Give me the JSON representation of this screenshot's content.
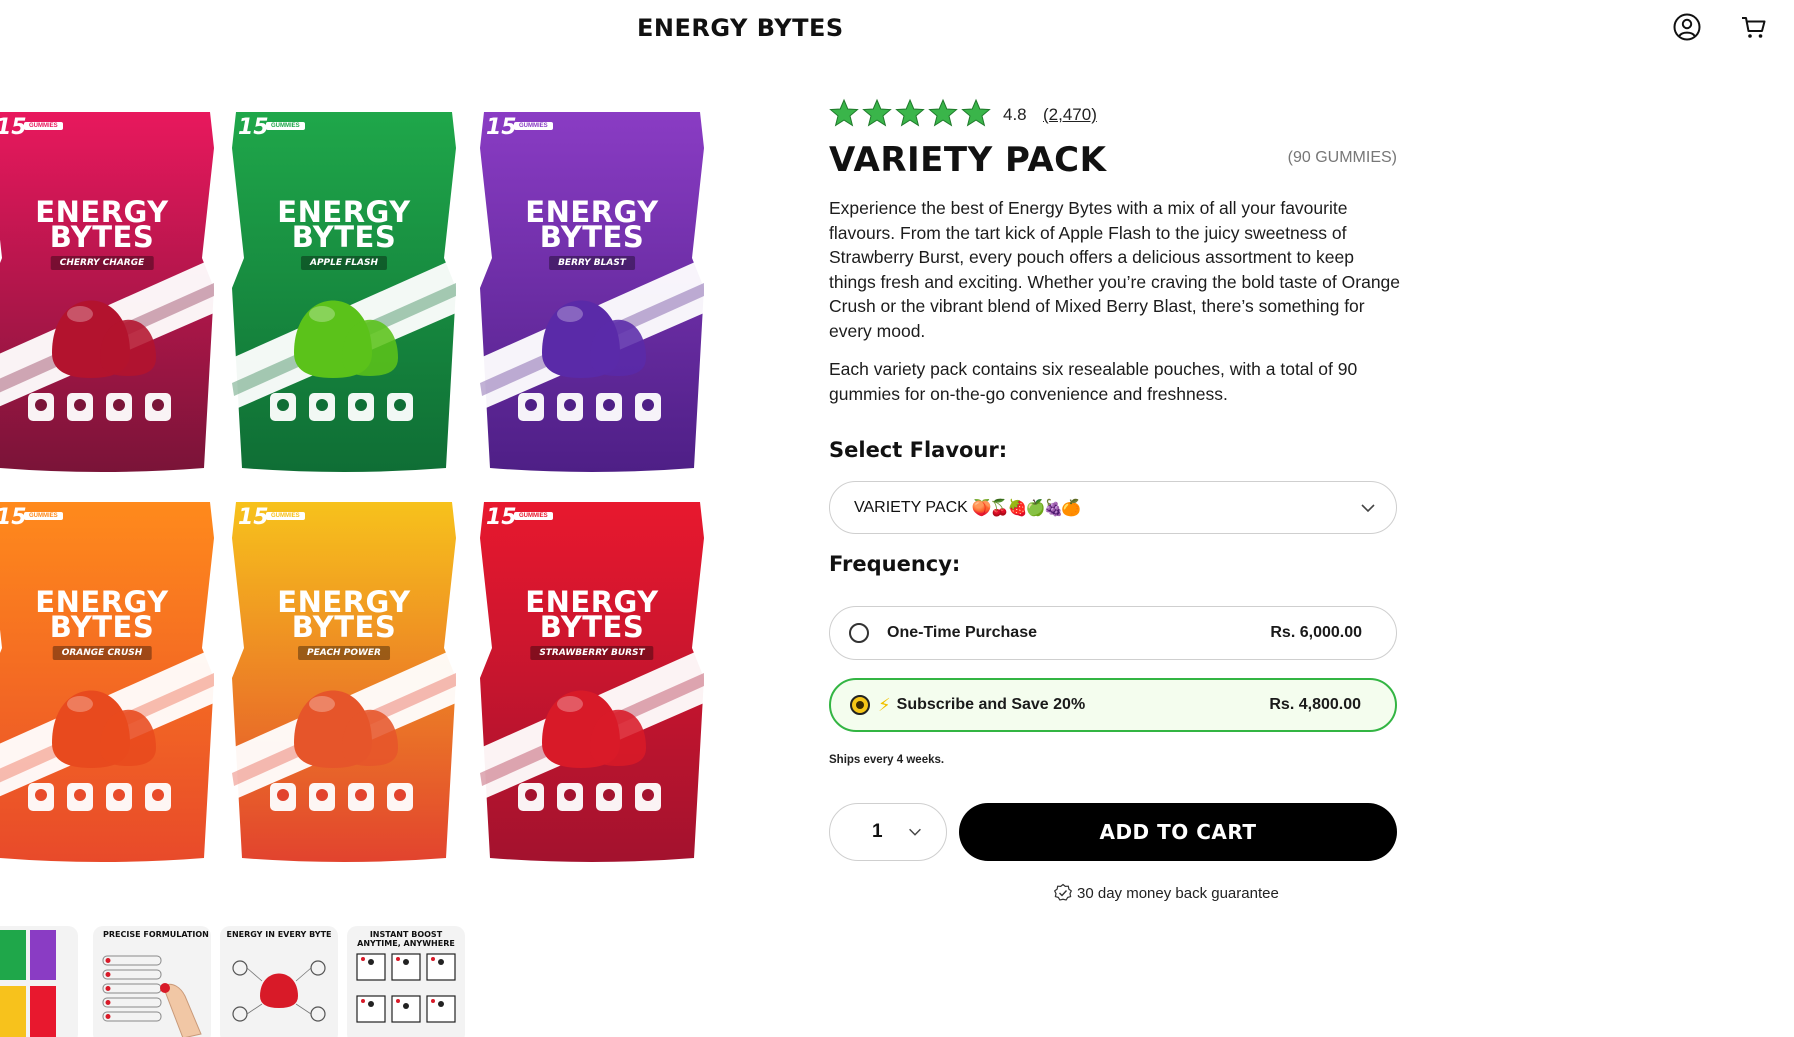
{
  "header": {
    "brand": "ENERGY BYTES",
    "account_icon": "user-circle-icon",
    "cart_icon": "cart-icon"
  },
  "gallery": {
    "pouches": [
      {
        "count": "15",
        "count_label": "GUMMIES",
        "brand_line1": "ENERGY",
        "brand_line2": "BYTES",
        "flavour": "CHERRY CHARGE",
        "color_top": "#e8185d",
        "color_bottom": "#7a1438",
        "gummy": "#b3132e"
      },
      {
        "count": "15",
        "count_label": "GUMMIES",
        "brand_line1": "ENERGY",
        "brand_line2": "BYTES",
        "flavour": "APPLE FLASH",
        "color_top": "#1fa74a",
        "color_bottom": "#0f6e35",
        "gummy": "#5bc21a"
      },
      {
        "count": "15",
        "count_label": "GUMMIES",
        "brand_line1": "ENERGY",
        "brand_line2": "BYTES",
        "flavour": "BERRY BLAST",
        "color_top": "#8a3cc4",
        "color_bottom": "#4e1f86",
        "gummy": "#5a2aa8"
      },
      {
        "count": "15",
        "count_label": "GUMMIES",
        "brand_line1": "ENERGY",
        "brand_line2": "BYTES",
        "flavour": "ORANGE CRUSH",
        "color_top": "#ff8a1c",
        "color_bottom": "#e84a2a",
        "gummy": "#e84a1e"
      },
      {
        "count": "15",
        "count_label": "GUMMIES",
        "brand_line1": "ENERGY",
        "brand_line2": "BYTES",
        "flavour": "PEACH POWER",
        "color_top": "#f7c21c",
        "color_bottom": "#e2432e",
        "gummy": "#e6552a"
      },
      {
        "count": "15",
        "count_label": "GUMMIES",
        "brand_line1": "ENERGY",
        "brand_line2": "BYTES",
        "flavour": "STRAWBERRY BURST",
        "color_top": "#e8182e",
        "color_bottom": "#a3122e",
        "gummy": "#d81a28"
      }
    ],
    "thumbnails": [
      {
        "title": ""
      },
      {
        "title": "PRECISE FORMULATION"
      },
      {
        "title": "ENERGY IN EVERY BYTE"
      },
      {
        "title": "INSTANT BOOST ANYTIME, ANYWHERE"
      }
    ]
  },
  "product": {
    "rating": "4.8",
    "reviews": "(2,470)",
    "star_color": "#3ab54a",
    "title": "VARIETY PACK",
    "gummies": "(90 GUMMIES)",
    "description_1": "Experience the best of Energy Bytes with a mix of all your favourite flavours. From the tart kick of Apple Flash to the juicy sweetness of Strawberry Burst, every pouch offers a delicious assortment to keep things fresh and exciting. Whether you’re craving the bold taste of Orange Crush or the vibrant blend of Mixed Berry Blast, there’s something for every mood.",
    "description_2": "Each variety pack contains six resealable pouches, with a total of 90 gummies for on-the-go convenience and freshness.",
    "flavour_label": "Select Flavour:",
    "flavour_value": "VARIETY PACK",
    "flavour_emojis": "🍑🍒🍓🍏🍇🍊",
    "frequency_label": "Frequency:",
    "options": [
      {
        "label": "One-Time Purchase",
        "price": "Rs. 6,000.00",
        "selected": false
      },
      {
        "label": "Subscribe and Save 20%",
        "price": "Rs. 4,800.00",
        "selected": true,
        "icon": "lightning-icon"
      }
    ],
    "ships_note": "Ships every 4 weeks.",
    "quantity": "1",
    "add_to_cart": "ADD TO CART",
    "guarantee": "30 day money back guarantee",
    "accent": "#33b543"
  }
}
